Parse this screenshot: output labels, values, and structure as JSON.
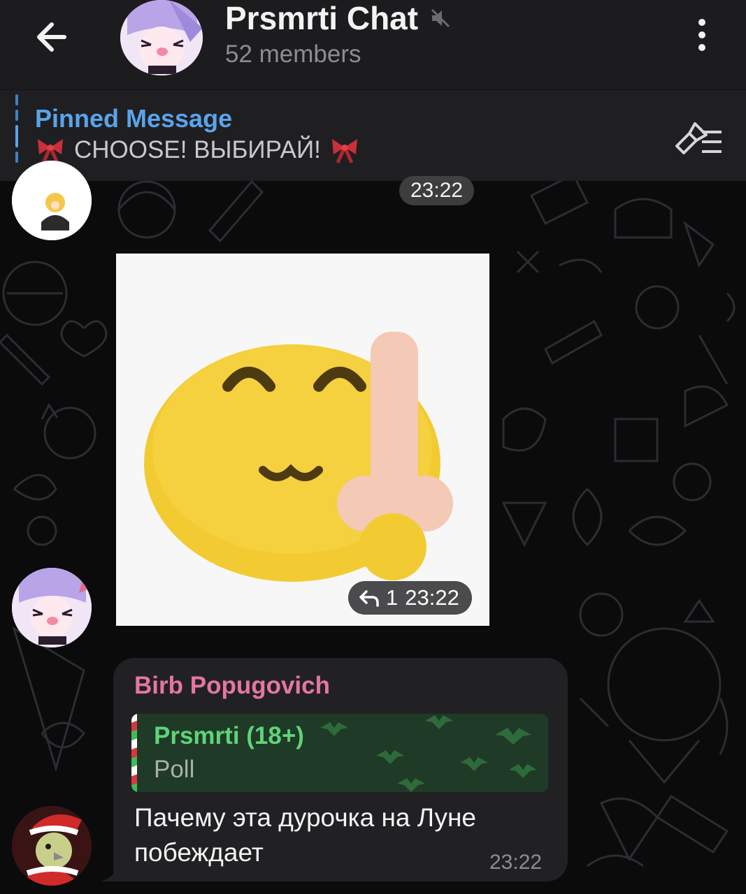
{
  "header": {
    "back_icon": "arrow-left-icon",
    "title": "Prsmrti Chat",
    "mute_icon": "muted-speaker-icon",
    "members": "52 members",
    "menu_icon": "more-vertical-icon"
  },
  "pinned": {
    "title": "Pinned Message",
    "text": "CHOOSE! ВЫБИРАЙ!",
    "bow_icon": "ribbon-bow-icon",
    "list_icon": "pinned-list-icon"
  },
  "messages": [
    {
      "type": "sticker",
      "time_top": "23:22",
      "reply_count": "1",
      "time": "23:22",
      "reply_icon": "reply-arrow-icon"
    },
    {
      "type": "text",
      "sender": "Birb Popugovich",
      "quote": {
        "name": "Prsmrti (18+)",
        "kind": "Poll"
      },
      "text": "Пачему эта дурочка на Луне побеждает",
      "time": "23:22"
    }
  ],
  "colors": {
    "accent": "#5aa3ec",
    "sender": "#e576a0",
    "quote_name": "#5fd37a",
    "bubble": "#212124"
  }
}
